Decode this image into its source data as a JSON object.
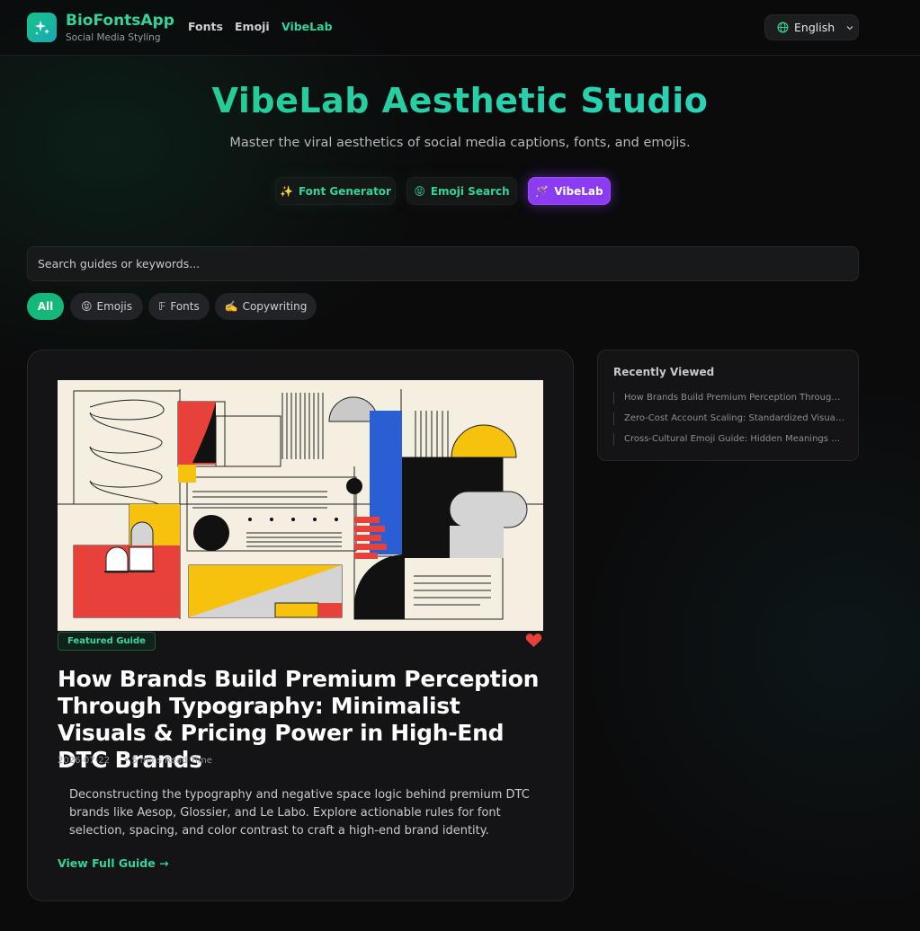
{
  "nav": {
    "brand_name": "BioFontsApp",
    "brand_sub": "Social Media Styling",
    "links": [
      "Fonts",
      "Emoji",
      "VibeLab"
    ],
    "language": "English"
  },
  "hero": {
    "title": "VibeLab Aesthetic Studio",
    "subtitle": "Master the viral aesthetics of social media captions, fonts, and emojis.",
    "buttons": [
      {
        "icon": "✨",
        "label": "Font Generator"
      },
      {
        "icon": "😝",
        "label": "Emoji Search"
      },
      {
        "icon": "🪄",
        "label": "VibeLab"
      }
    ]
  },
  "search": {
    "placeholder": "Search guides or keywords..."
  },
  "filters": [
    {
      "icon": "",
      "label": "All"
    },
    {
      "icon": "😝",
      "label": "Emojis"
    },
    {
      "icon": "𝔽",
      "label": "Fonts"
    },
    {
      "icon": "✍️",
      "label": "Copywriting"
    }
  ],
  "card": {
    "badge": "Featured Guide",
    "title": "How Brands Build Premium Perception Through Typography: Minimalist Visuals & Pricing Power in High-End DTC Brands",
    "date": "2026-07-22",
    "read_time": "• 5 mins Read Time",
    "description": "Deconstructing the typography and negative space logic behind premium DTC brands like Aesop, Glossier, and Le Labo. Explore actionable rules for font selection, spacing, and color contrast to craft a high-end brand identity.",
    "cta": "View Full Guide →"
  },
  "recent": {
    "title": "Recently Viewed",
    "items": [
      "How Brands Build Premium Perception Through Typography: Minimalist Visuals & Pricing Power in High-End DTC Brands",
      "Zero-Cost Account Scaling: Standardized Visual Content System",
      "Cross-Cultural Emoji Guide: Hidden Meanings and Regional Differences"
    ]
  },
  "colors": {
    "accent": "#2fd39a",
    "active_purple": "#8b3cf2",
    "chip_active": "#14b878",
    "heart": "#e8413a"
  }
}
